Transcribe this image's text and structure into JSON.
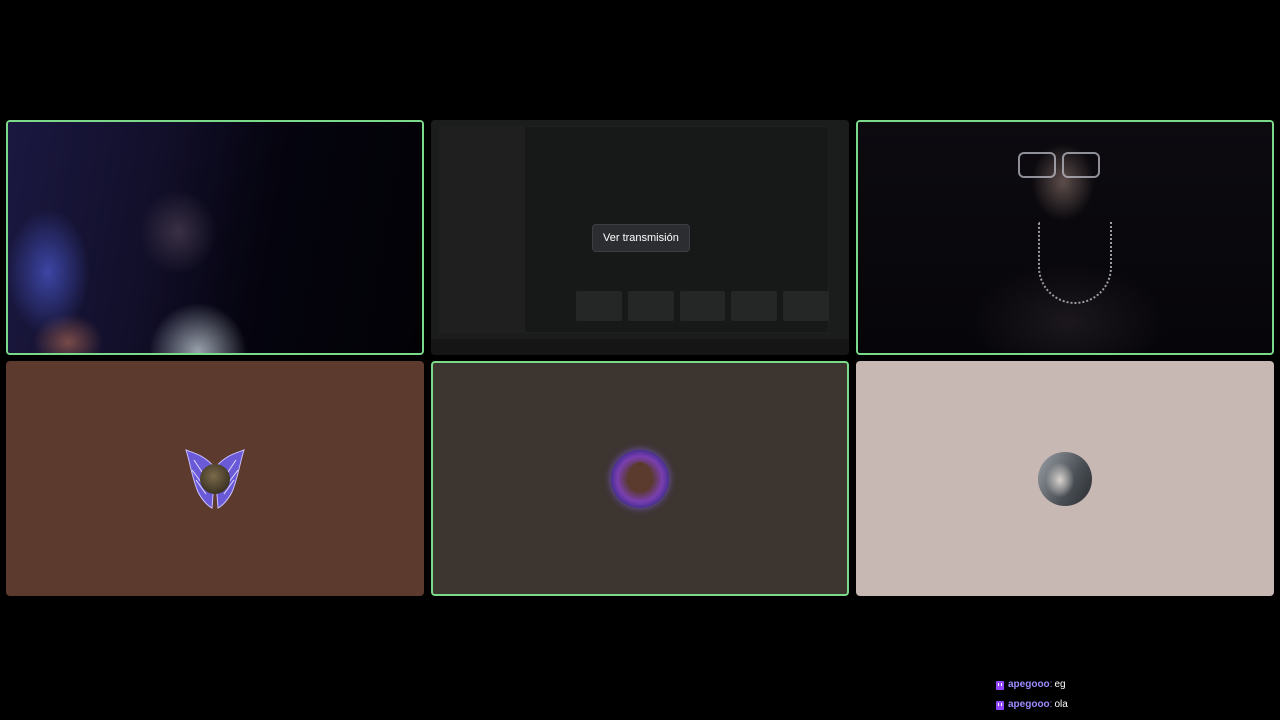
{
  "tiles": [
    {
      "kind": "camera",
      "speaking": true
    },
    {
      "kind": "screen-share",
      "speaking": false,
      "watch_label": "Ver transmisión"
    },
    {
      "kind": "camera",
      "speaking": true
    },
    {
      "kind": "avatar",
      "background": "#5c3a2e",
      "speaking": false
    },
    {
      "kind": "avatar",
      "background": "#3d3530",
      "speaking": true
    },
    {
      "kind": "avatar",
      "background": "#c7b8b4",
      "speaking": false
    }
  ],
  "colors": {
    "speaking_border": "#7bd98a",
    "twitch_purple": "#9146ff",
    "username": "#9b8cff"
  },
  "chat": {
    "messages": [
      {
        "user": "apegooo",
        "separator": ":",
        "text": "eg"
      },
      {
        "user": "apegooo",
        "separator": ":",
        "text": "ola"
      }
    ]
  }
}
